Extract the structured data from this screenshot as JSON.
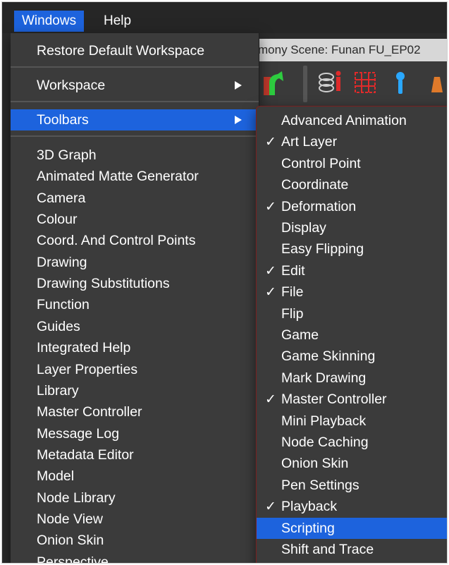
{
  "menubar": {
    "items": [
      {
        "label": "Windows",
        "active": true
      },
      {
        "label": "Help",
        "active": false
      }
    ]
  },
  "background_window": {
    "title": "mony Scene: Funan FU_EP02",
    "toolbar_icons": [
      "transform-tool-icon",
      "layers-icon",
      "grid-icon",
      "pin-icon",
      "pen-icon"
    ]
  },
  "windows_menu": {
    "restore_label": "Restore Default Workspace",
    "workspace_label": "Workspace",
    "toolbars_label": "Toolbars",
    "views": [
      "3D Graph",
      "Animated Matte Generator",
      "Camera",
      "Colour",
      "Coord. And Control Points",
      "Drawing",
      "Drawing Substitutions",
      "Function",
      "Guides",
      "Integrated Help",
      "Layer Properties",
      "Library",
      "Master Controller",
      "Message Log",
      "Metadata Editor",
      "Model",
      "Node Library",
      "Node View",
      "Onion Skin",
      "Perspective"
    ]
  },
  "toolbars_menu": {
    "checkmark": "✓",
    "items": [
      {
        "label": "Advanced Animation",
        "checked": false
      },
      {
        "label": "Art Layer",
        "checked": true
      },
      {
        "label": "Control Point",
        "checked": false
      },
      {
        "label": "Coordinate",
        "checked": false
      },
      {
        "label": "Deformation",
        "checked": true
      },
      {
        "label": "Display",
        "checked": false
      },
      {
        "label": "Easy Flipping",
        "checked": false
      },
      {
        "label": "Edit",
        "checked": true
      },
      {
        "label": "File",
        "checked": true
      },
      {
        "label": "Flip",
        "checked": false
      },
      {
        "label": "Game",
        "checked": false
      },
      {
        "label": "Game Skinning",
        "checked": false
      },
      {
        "label": "Mark Drawing",
        "checked": false
      },
      {
        "label": "Master Controller",
        "checked": true
      },
      {
        "label": "Mini Playback",
        "checked": false
      },
      {
        "label": "Node Caching",
        "checked": false
      },
      {
        "label": "Onion Skin",
        "checked": false
      },
      {
        "label": "Pen Settings",
        "checked": false
      },
      {
        "label": "Playback",
        "checked": true
      },
      {
        "label": "Scripting",
        "checked": false,
        "highlighted": true
      },
      {
        "label": "Shift and Trace",
        "checked": false
      }
    ]
  },
  "colors": {
    "highlight": "#1d63dd",
    "menu_bg": "#3b3b3b",
    "menubar_bg": "#262626"
  }
}
